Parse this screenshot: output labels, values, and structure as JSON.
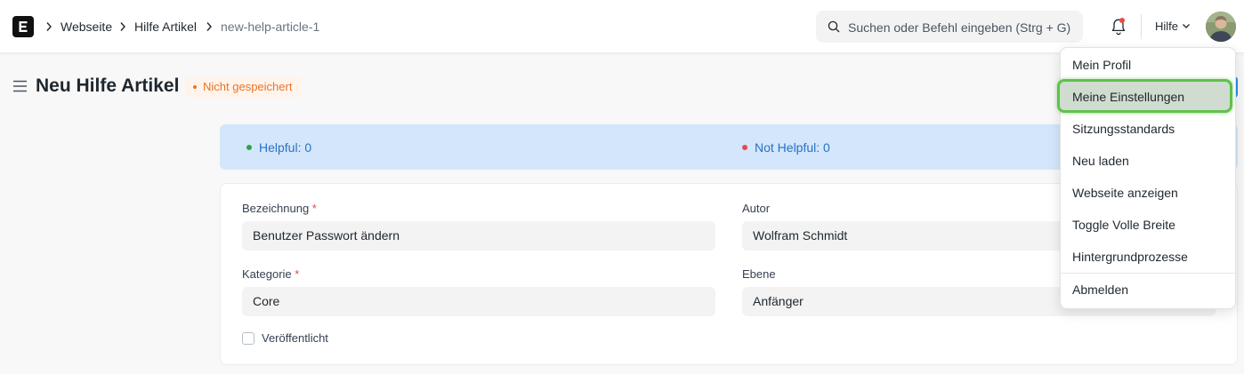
{
  "navbar": {
    "breadcrumbs": [
      "Webseite",
      "Hilfe Artikel",
      "new-help-article-1"
    ],
    "search_placeholder": "Suchen oder Befehl eingeben (Strg + G)",
    "help_label": "Hilfe"
  },
  "header": {
    "title": "Neu Hilfe Artikel",
    "status": "Nicht gespeichert"
  },
  "feedback": {
    "helpful": "Helpful: 0",
    "not_helpful": "Not Helpful: 0"
  },
  "form": {
    "title_label": "Bezeichnung",
    "title_value": "Benutzer Passwort ändern",
    "author_label": "Autor",
    "author_value": "Wolfram Schmidt",
    "category_label": "Kategorie",
    "category_value": "Core",
    "level_label": "Ebene",
    "level_value": "Anfänger",
    "published_label": "Veröffentlicht",
    "required_marker": "*"
  },
  "user_menu": {
    "items": [
      "Mein Profil",
      "Meine Einstellungen",
      "Sitzungsstandards",
      "Neu laden",
      "Webseite anzeigen",
      "Toggle Volle Breite",
      "Hintergrundprozesse",
      "Abmelden"
    ],
    "highlighted_item": "Meine Einstellungen"
  },
  "colors": {
    "status_orange": "#e8742b",
    "helpful_green": "#28a745",
    "not_helpful_red": "#e24c4c",
    "feedback_bg": "#d3e6fb",
    "highlight_border": "#5ec24a"
  },
  "icons": [
    "app-logo-icon",
    "chevron-right-icon",
    "search-icon",
    "bell-icon",
    "chevron-down-icon",
    "hamburger-icon"
  ]
}
